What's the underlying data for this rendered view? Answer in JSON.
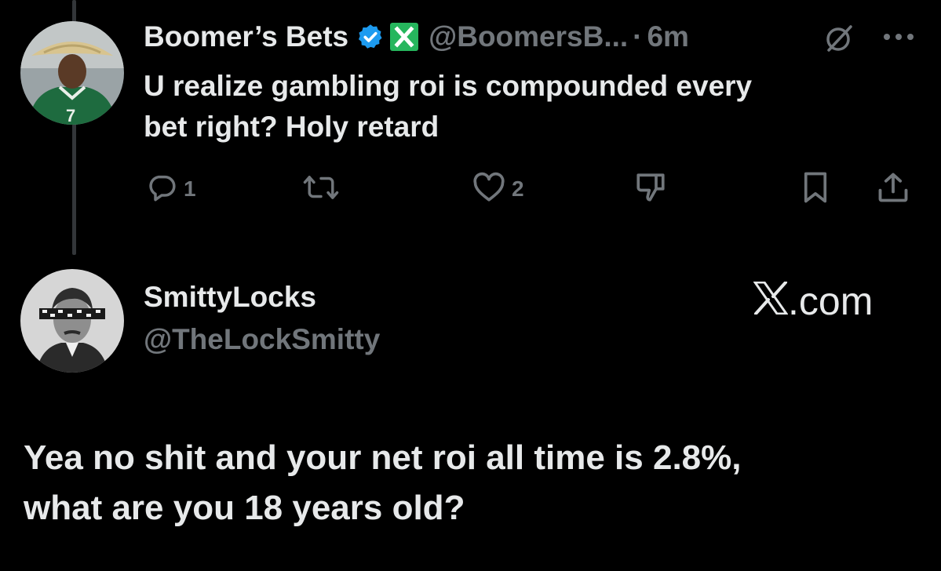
{
  "tweet": {
    "author_name": "Boomer’s Bets",
    "author_handle": "@BoomersB...",
    "separator": "·",
    "time": "6m",
    "text_line1": "U realize gambling roi is compounded every",
    "text_line2": "bet right? Holy retard",
    "reply_count": "1",
    "like_count": "2",
    "badges": [
      "verified-badge-icon",
      "x-square-badge-icon"
    ],
    "colors": {
      "verified": "#1d9bf0",
      "x_badge": "#26b65d",
      "muted": "#71767b",
      "text": "#e7e9ea"
    }
  },
  "reply": {
    "author_name": "SmittyLocks",
    "author_handle": "@TheLockSmitty",
    "watermark": ".com",
    "text_line1": "Yea no shit and your net roi all time is 2.8%,",
    "text_line2": "what are you 18 years old?"
  }
}
